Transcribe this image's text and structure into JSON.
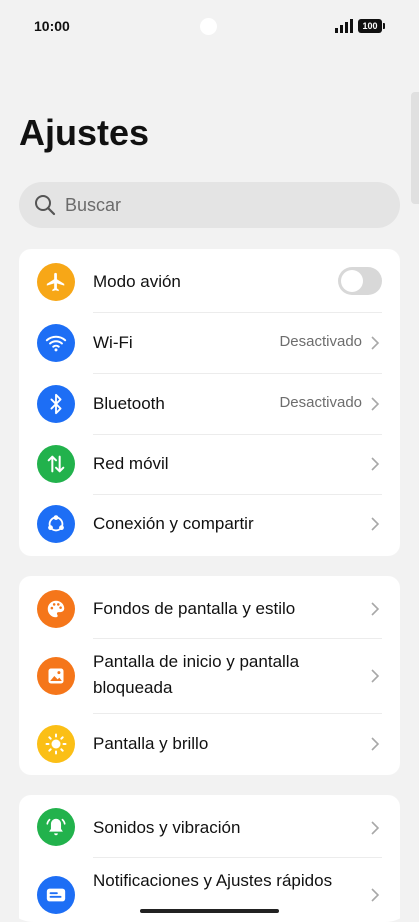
{
  "status": {
    "time": "10:00",
    "battery": "100"
  },
  "page": {
    "title": "Ajustes"
  },
  "search": {
    "placeholder": "Buscar"
  },
  "colors": {
    "orange": "#f7a717",
    "blue": "#1d6ef5",
    "green": "#22b24c",
    "deep_orange": "#f5761a",
    "yellow": "#fbbf16"
  },
  "groups": [
    {
      "items": [
        {
          "label": "Modo avión",
          "icon": "airplane-icon",
          "control": "toggle",
          "toggle_on": false
        },
        {
          "label": "Wi-Fi",
          "icon": "wifi-icon",
          "value": "Desactivado"
        },
        {
          "label": "Bluetooth",
          "icon": "bluetooth-icon",
          "value": "Desactivado"
        },
        {
          "label": "Red móvil",
          "icon": "mobile-data-icon"
        },
        {
          "label": "Conexión y compartir",
          "icon": "share-connection-icon"
        }
      ]
    },
    {
      "items": [
        {
          "label": "Fondos de pantalla y estilo",
          "icon": "palette-icon"
        },
        {
          "label": "Pantalla de inicio y pantalla bloqueada",
          "icon": "home-lock-screen-icon"
        },
        {
          "label": "Pantalla y brillo",
          "icon": "brightness-icon"
        }
      ]
    },
    {
      "items": [
        {
          "label": "Sonidos y vibración",
          "icon": "bell-icon"
        },
        {
          "label": "Notificaciones y Ajustes rápidos",
          "icon": "notifications-icon"
        }
      ]
    }
  ]
}
